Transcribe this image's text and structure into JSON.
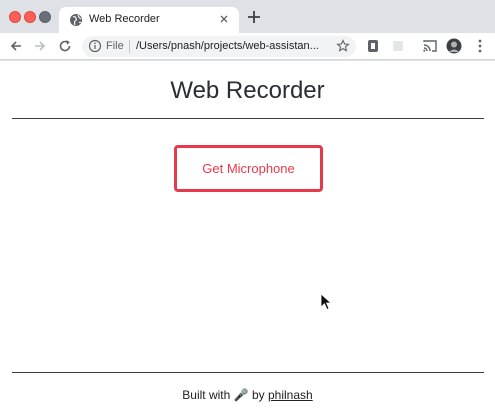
{
  "browser": {
    "tab": {
      "title": "Web Recorder"
    },
    "omnibox": {
      "scheme_label": "File",
      "url": "/Users/pnash/projects/web-assistan..."
    }
  },
  "page": {
    "title": "Web Recorder",
    "button_label": "Get Microphone",
    "footer": {
      "prefix": "Built with",
      "emoji": "🎤",
      "by": "by",
      "author": "philnash"
    }
  },
  "colors": {
    "accent": "#e6394b",
    "text": "#2a2d34"
  }
}
